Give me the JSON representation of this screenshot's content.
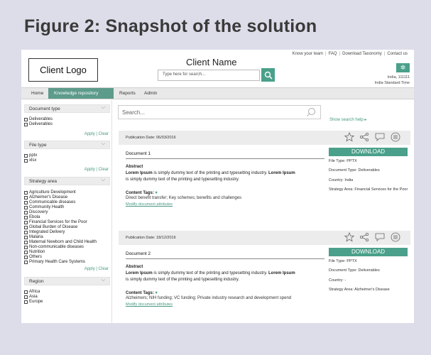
{
  "figure_title": "Figure 2: Snapshot of the solution",
  "header": {
    "top_links": [
      "Know your team",
      "FAQ",
      "Download Taxonomy",
      "Contact us"
    ],
    "logo_text": "Client Logo",
    "client_name": "Client Name",
    "search_placeholder": "Type here for search...",
    "location_country": "India, 111111",
    "location_time": "India Standard Time"
  },
  "nav": {
    "tabs": [
      "Home",
      "Knowledge repository",
      "Reports",
      "Admin"
    ],
    "active": "Knowledge repository",
    "accent_color": "#5d9b8a"
  },
  "sidebar": {
    "apply_label": "Apply | Clear",
    "filters": [
      {
        "title": "Document type",
        "options": [
          "Deliverables",
          "Deliverables"
        ]
      },
      {
        "title": "File type",
        "options": [
          "pptx",
          "xlsx"
        ]
      },
      {
        "title": "Strategy area",
        "options": [
          "Agriculture Development",
          "Alzheimer's Disease",
          "Communicable diseases",
          "Community Health",
          "Discovery",
          "Ebola",
          "Financial Services for the Poor",
          "Global Burden of Disease",
          "Integrated Delivery",
          "Malaria",
          "Maternal Newborn and Child Health",
          "Non-communicable diseases",
          "Nutrition",
          "Others",
          "Primary Health Care Systems"
        ]
      },
      {
        "title": "Region",
        "options": [
          "Africa",
          "Asia",
          "Europe"
        ]
      }
    ]
  },
  "content": {
    "search_placeholder": "Search...",
    "search_help": "Show search help ▸",
    "download_label": "DOWNLOAD",
    "abstract_label": "Abstract",
    "tags_label": "Content Tags:",
    "modify_label": "Modify document attributes",
    "documents": [
      {
        "publication": "Publication Date: 06/03/2016",
        "title": "Document 1",
        "abstract_bold": "Lorem Ipsum",
        "abstract_text": " is simply dummy text of the printing and typesetting industry. ",
        "abstract_bold2": "Lorem Ipsum",
        "abstract_text2": " is simply dummy text of the printing and typesetting industry.",
        "tags": "Direct benefit transfer; Key schemes; benefits and challenges",
        "file_type": "File Type: PPTX",
        "doc_type": "Document Type: Deliverables",
        "country": "Country: India",
        "strategy": "Strategy Area: Financial Services for the Poor"
      },
      {
        "publication": "Publication Date: 18/12/2016",
        "title": "Document 2",
        "abstract_bold": "Lorem Ipsum",
        "abstract_text": " is simply dummy text of the printing and typesetting industry. ",
        "abstract_bold2": "Lorem Ipsum",
        "abstract_text2": " is simply dummy text of the printing and typesetting industry.",
        "tags": "Alzheimers; NIH funding; VC funding; Private industry research and development spend",
        "file_type": "File Type: PPTX",
        "doc_type": "Document Type: Deliverables",
        "country": "Country: -",
        "strategy": "Strategy Area: Alzheimer's Disease"
      }
    ]
  }
}
